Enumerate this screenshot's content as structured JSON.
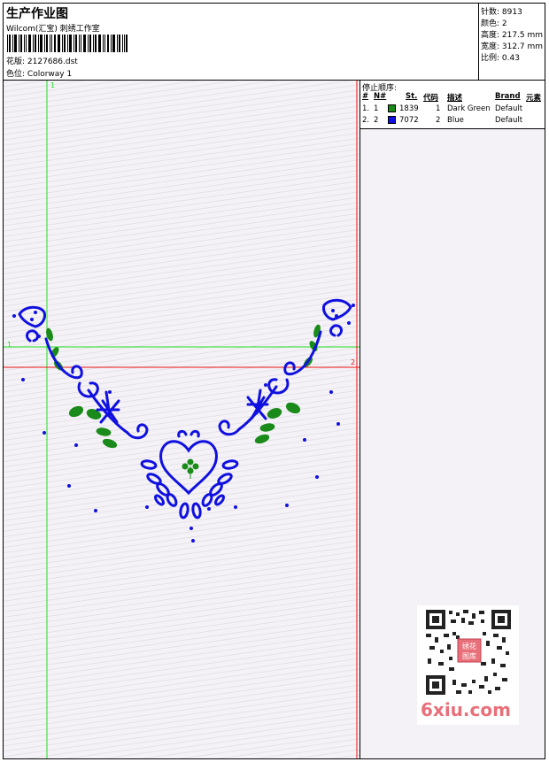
{
  "header": {
    "title": "生产作业图",
    "studio": "Wilcom(汇宝) 刺绣工作室",
    "design_label": "花版:",
    "design_value": "2127686.dst",
    "colorway_label": "色位:",
    "colorway_value": "Colorway 1"
  },
  "stats": {
    "stitches": "针数: 8913",
    "colors": "颜色: 2",
    "height": "高度: 217.5 mm",
    "width": "宽度: 312.7 mm",
    "scale": "比例: 0.43"
  },
  "stop_sequence": {
    "title": "停止顺序:",
    "columns": [
      "#",
      "N#",
      "St.",
      "代码",
      "描述",
      "Brand",
      "元素"
    ],
    "rows": [
      {
        "num": "1.",
        "n": "1",
        "stitches": "1839",
        "code": "1",
        "description": "Dark Green",
        "brand": "Default",
        "color": "#1a8a1a"
      },
      {
        "num": "2.",
        "n": "2",
        "stitches": "7072",
        "code": "2",
        "description": "Blue",
        "brand": "Default",
        "color": "#1010e0"
      }
    ]
  },
  "guides": {
    "green_v_label": "1",
    "green_h_label": "1",
    "red_h_label": "2",
    "red_v_label": "2"
  },
  "watermark": {
    "text": "6xiu.com",
    "stamp": "绣花图库"
  },
  "colors": {
    "thread_green": "#1a8a1a",
    "thread_blue": "#1010e0",
    "guide_green": "#22dd22",
    "guide_red": "#ee1111"
  }
}
